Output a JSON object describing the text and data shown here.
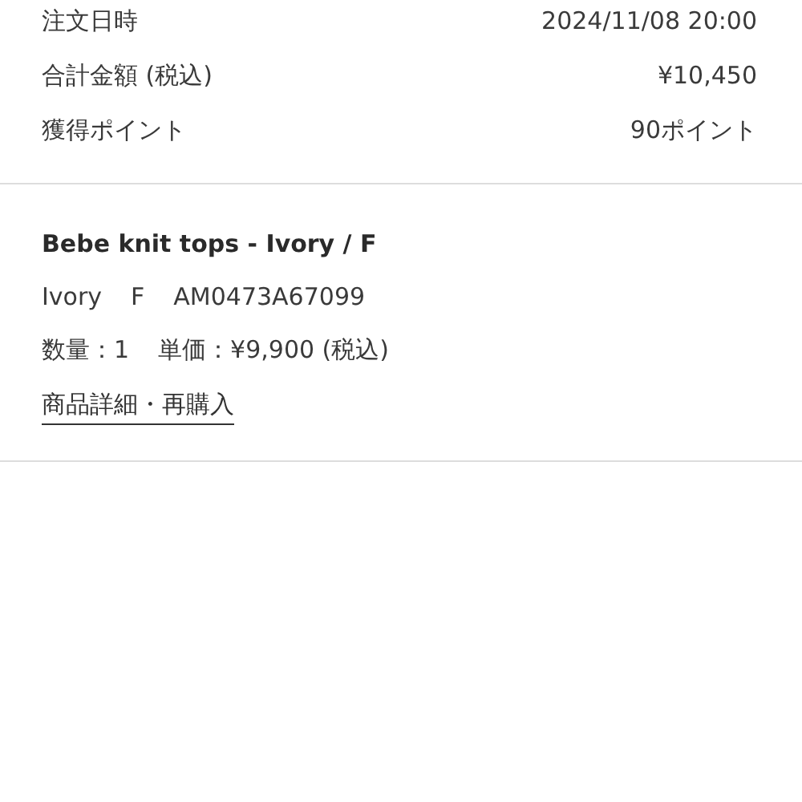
{
  "summary": [
    {
      "label": "注文日時",
      "value": "2024/11/08 20:00"
    },
    {
      "label": "合計金額 (税込)",
      "value": "¥10,450"
    },
    {
      "label": "獲得ポイント",
      "value": "90ポイント"
    }
  ],
  "item": {
    "title": "Bebe knit tops - Ivory / F",
    "variant": [
      "Ivory",
      "F",
      "AM0473A67099"
    ],
    "quantity": "数量：1",
    "unit_price": "単価：¥9,900 (税込)",
    "link": "商品詳細・再購入"
  }
}
